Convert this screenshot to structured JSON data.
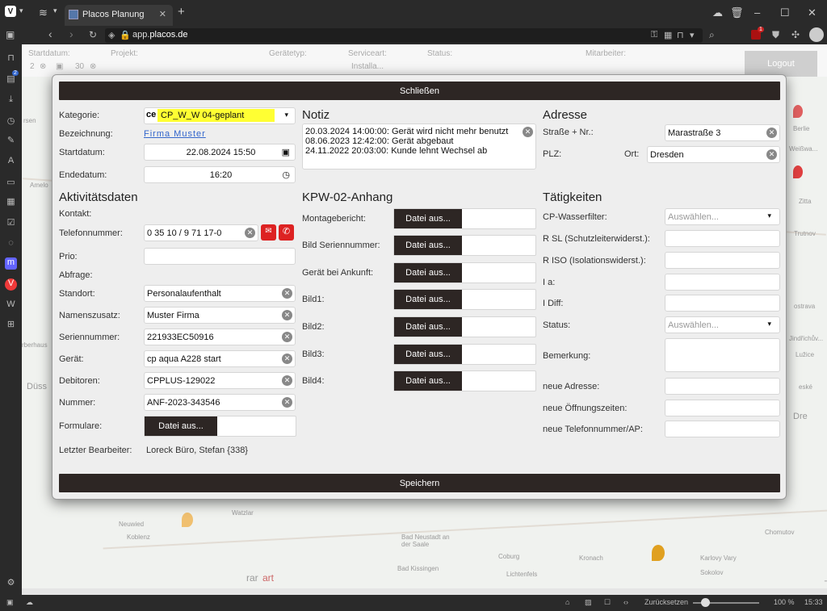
{
  "browser": {
    "tab_title": "Placos Planung",
    "url_prefix": "app.",
    "url_domain": "placos.de",
    "clock": "15:33",
    "zoom_reset": "Zurücksetzen",
    "zoom": "100 %",
    "mail_badge": "1",
    "panel_badge": "2"
  },
  "filters": {
    "startdatum": "Startdatum:",
    "start_value": "2",
    "start_value2": "30",
    "projekt": "Projekt:",
    "geraetetyp": "Gerätetyp:",
    "serviceart": "Serviceart:",
    "serviceart_value": "Installa...",
    "status": "Status:",
    "mitarbeiter": "Mitarbeiter:",
    "logout": "Logout"
  },
  "map_labels": {
    "rsen": "rsen",
    "amelo": "Amelo",
    "rberhaus": "rberhaus",
    "duss": "Düss",
    "weisswasser": "Weißwa...",
    "berlie": "Berlie",
    "zitta": "Zitta",
    "trutnov": "Trutnov",
    "ostrava": "ostrava",
    "jindrichuv": "Jindřichův...",
    "luzice": "Lužice",
    "eske": "eské",
    "dre": "Dre",
    "watzlar": "Watzlar",
    "neuwied": "Neuwied",
    "koblenz": "Koblenz",
    "badneustadt": "Bad Neustadt an der Saale",
    "chomutov": "Chomutov",
    "coburg": "Coburg",
    "kronach": "Kronach",
    "karlovy": "Karlovy Vary",
    "badkissingen": "Bad Kissingen",
    "lichtenfels": "Lichtenfels",
    "sokolov": "Sokolov",
    "rar": "rar",
    "art": "art"
  },
  "modal": {
    "close": "Schließen",
    "save": "Speichern",
    "left": {
      "kategorie_label": "Kategorie:",
      "kategorie_value": "CP_W_W 04-geplant",
      "bezeichnung_label": "Bezeichnung:",
      "bezeichnung_value": "Firma Muster",
      "startdatum_label": "Startdatum:",
      "startdatum_value": "22.08.2024 15:50",
      "endedatum_label": "Endedatum:",
      "endedatum_value": "16:20",
      "aktivitaet_heading": "Aktivitätsdaten",
      "kontakt_label": "Kontakt:",
      "telefon_label": "Telefonnummer:",
      "telefon_value": "0 35 10 / 9 71 17-0",
      "prio_label": "Prio:",
      "abfrage_label": "Abfrage:",
      "standort_label": "Standort:",
      "standort_value": "Personalaufenthalt",
      "namenszusatz_label": "Namenszusatz:",
      "namenszusatz_value": "Muster Firma",
      "seriennummer_label": "Seriennummer:",
      "seriennummer_value": "221933EC50916",
      "geraet_label": "Gerät:",
      "geraet_value": "cp aqua A228 start",
      "debitoren_label": "Debitoren:",
      "debitoren_value": "CPPLUS-129022",
      "nummer_label": "Nummer:",
      "nummer_value": "ANF-2023-343546",
      "formulare_label": "Formulare:",
      "letzter_label": "Letzter Bearbeiter:",
      "letzter_value": "Loreck Büro, Stefan {338}"
    },
    "file_button": "Datei aus...",
    "middle": {
      "notiz_heading": "Notiz",
      "notes": [
        "20.03.2024 14:00:00: Gerät wird nicht mehr benutzt",
        "08.06.2023 12:42:00: Gerät abgebaut",
        "24.11.2022 20:03:00: Kunde lehnt Wechsel ab"
      ],
      "kpw_heading": "KPW-02-Anhang",
      "montage_label": "Montagebericht:",
      "bild_serien_label": "Bild Seriennummer:",
      "ankunft_label": "Gerät bei Ankunft:",
      "bild1_label": "Bild1:",
      "bild2_label": "Bild2:",
      "bild3_label": "Bild3:",
      "bild4_label": "Bild4:"
    },
    "right": {
      "adresse_heading": "Adresse",
      "strasse_label": "Straße + Nr.:",
      "strasse_value": "Marastraße 3",
      "plz_label": "PLZ:",
      "ort_label": "Ort:",
      "ort_value": "Dresden",
      "taetigkeiten_heading": "Tätigkeiten",
      "wasserfilter_label": "CP-Wasserfilter:",
      "select_placeholder": "Auswählen...",
      "rsl_label": "R SL (Schutzleiterwiderst.):",
      "riso_label": "R ISO (Isolationswiderst.):",
      "ia_label": "I a:",
      "idiff_label": "I Diff:",
      "status_label": "Status:",
      "bemerkung_label": "Bemerkung:",
      "neue_adresse_label": "neue Adresse:",
      "neue_oeffnung_label": "neue Öffnungszeiten:",
      "neue_telefon_label": "neue Telefonnummer/AP:"
    }
  },
  "colors": {
    "accent": "#2d2624",
    "highlight": "#ffff33",
    "phone_icon": "#dd2222"
  }
}
